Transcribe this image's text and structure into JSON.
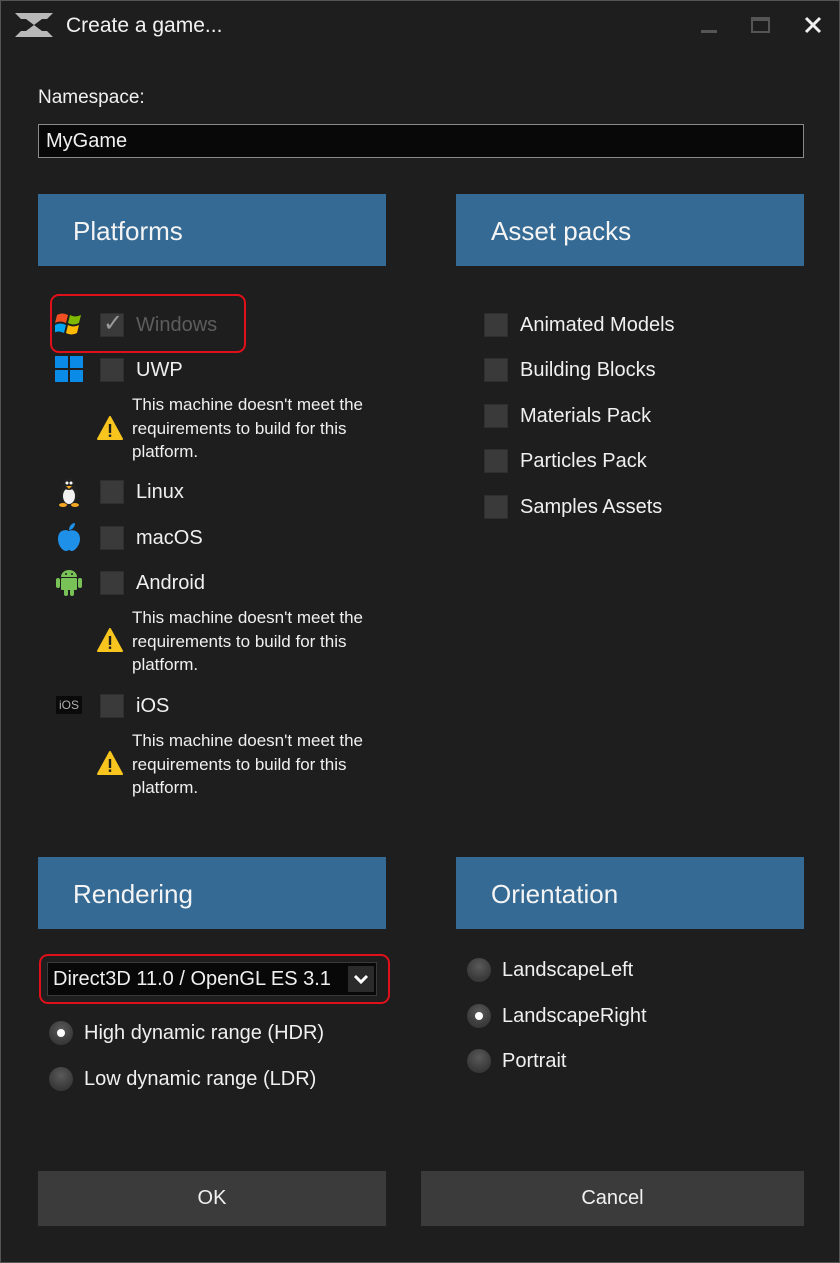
{
  "window": {
    "title": "Create a game..."
  },
  "namespace": {
    "label": "Namespace:",
    "value": "MyGame"
  },
  "platforms": {
    "header": "Platforms",
    "items": [
      {
        "label": "Windows",
        "checked": true,
        "disabled": true,
        "icon": "windows-xp-icon"
      },
      {
        "label": "UWP",
        "checked": false,
        "icon": "windows-icon",
        "warning": "This machine doesn't meet the requirements to build for this platform."
      },
      {
        "label": "Linux",
        "checked": false,
        "icon": "linux-tux-icon"
      },
      {
        "label": "macOS",
        "checked": false,
        "icon": "apple-icon"
      },
      {
        "label": "Android",
        "checked": false,
        "icon": "android-icon",
        "warning": "This machine doesn't meet the requirements to build for this platform."
      },
      {
        "label": "iOS",
        "checked": false,
        "icon": "ios-icon",
        "icon_text": "iOS",
        "warning": "This machine doesn't meet the requirements to build for this platform."
      }
    ]
  },
  "asset_packs": {
    "header": "Asset packs",
    "items": [
      {
        "label": "Animated Models",
        "checked": false
      },
      {
        "label": "Building Blocks",
        "checked": false
      },
      {
        "label": "Materials Pack",
        "checked": false
      },
      {
        "label": "Particles Pack",
        "checked": false
      },
      {
        "label": "Samples Assets",
        "checked": false
      }
    ]
  },
  "rendering": {
    "header": "Rendering",
    "graphics_api": "Direct3D 11.0 / OpenGL ES 3.1",
    "options": [
      {
        "label": "High dynamic range (HDR)",
        "selected": true
      },
      {
        "label": "Low dynamic range (LDR)",
        "selected": false
      }
    ]
  },
  "orientation": {
    "header": "Orientation",
    "options": [
      {
        "label": "LandscapeLeft",
        "selected": false
      },
      {
        "label": "LandscapeRight",
        "selected": true
      },
      {
        "label": "Portrait",
        "selected": false
      }
    ]
  },
  "buttons": {
    "ok": "OK",
    "cancel": "Cancel"
  },
  "colors": {
    "header_bg": "#346a94",
    "window_bg": "#1e1e1f",
    "highlight": "#e0101a"
  }
}
